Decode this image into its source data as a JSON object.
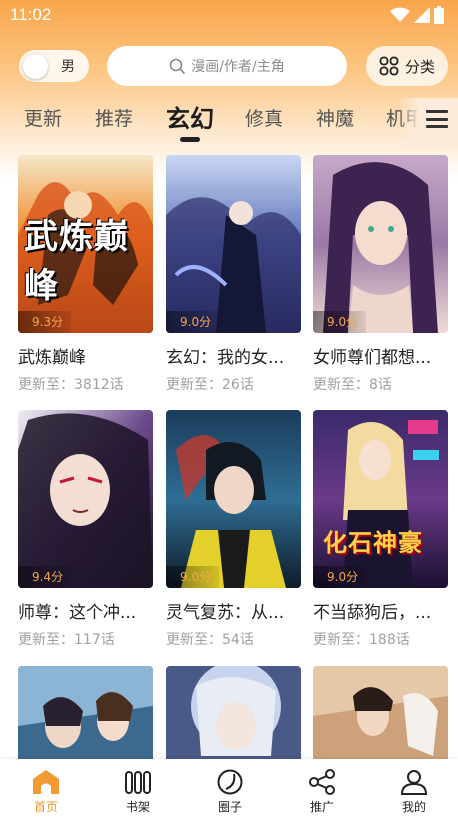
{
  "status_bar": {
    "time": "11:02"
  },
  "header": {
    "gender_label": "男",
    "search_placeholder": "漫画/作者/主角",
    "category_label": "分类"
  },
  "tabs": [
    "更新",
    "推荐",
    "玄幻",
    "修真",
    "神魔",
    "机甲"
  ],
  "active_tab": "玄幻",
  "comics": [
    {
      "title": "武炼巅峰",
      "cover_text": "武炼巅峰",
      "score": "9.3分",
      "update": "更新至：3812话"
    },
    {
      "title": "玄幻：我的女...",
      "score": "9.0分",
      "update": "更新至：26话"
    },
    {
      "title": "女师尊们都想...",
      "score": "9.0分",
      "update": "更新至：8话"
    },
    {
      "title": "师尊：这个冲...",
      "score": "9.4分",
      "update": "更新至：117话"
    },
    {
      "title": "灵气复苏：从...",
      "score": "9.0分",
      "update": "更新至：54话"
    },
    {
      "title": "不当舔狗后，...",
      "cover_text": "化石神豪",
      "score": "9.0分",
      "update": "更新至：188话"
    }
  ],
  "bottom_nav": [
    {
      "label": "首页",
      "icon": "home-icon",
      "active": true
    },
    {
      "label": "书架",
      "icon": "bookshelf-icon",
      "active": false
    },
    {
      "label": "圈子",
      "icon": "circle-icon",
      "active": false
    },
    {
      "label": "推广",
      "icon": "share-icon",
      "active": false
    },
    {
      "label": "我的",
      "icon": "user-icon",
      "active": false
    }
  ],
  "colors": {
    "accent": "#f19a32",
    "header_top": "#f9a54a",
    "score_text": "#f3a64e"
  }
}
